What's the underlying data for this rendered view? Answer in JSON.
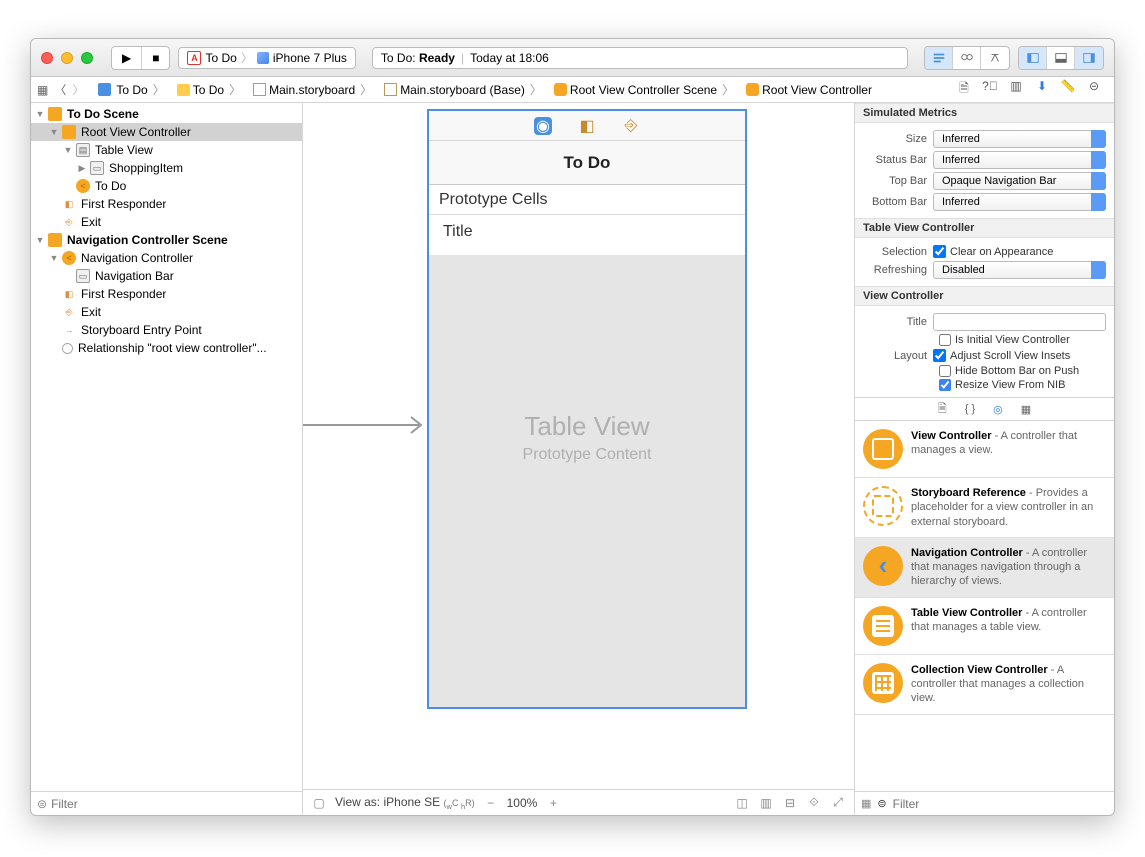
{
  "titlebar": {
    "scheme_app": "To Do",
    "scheme_device": "iPhone 7 Plus",
    "status_project": "To Do:",
    "status_state": "Ready",
    "status_time": "Today at 18:06"
  },
  "jumpbar": {
    "crumbs": [
      "To Do",
      "To Do",
      "Main.storyboard",
      "Main.storyboard (Base)",
      "Root View Controller Scene",
      "Root View Controller"
    ]
  },
  "outline": {
    "scene1": "To Do Scene",
    "rvc": "Root View Controller",
    "tv": "Table View",
    "cell": "ShoppingItem",
    "navitem": "To Do",
    "fr1": "First Responder",
    "exit1": "Exit",
    "scene2": "Navigation Controller Scene",
    "navc": "Navigation Controller",
    "navbar": "Navigation Bar",
    "fr2": "First Responder",
    "exit2": "Exit",
    "entry": "Storyboard Entry Point",
    "rel": "Relationship \"root view controller\"...",
    "filter_ph": "Filter"
  },
  "canvas": {
    "nav_title": "To Do",
    "proto_hdr": "Prototype Cells",
    "cell_title": "Title",
    "ph1": "Table View",
    "ph2": "Prototype Content",
    "footer_viewas": "View as: iPhone SE",
    "footer_wc": "(",
    "footer_w": "w",
    "footer_c": "C ",
    "footer_h": "h",
    "footer_r": "R",
    "footer_close": ")",
    "zoom": "100%"
  },
  "inspector": {
    "sim_metrics": {
      "header": "Simulated Metrics",
      "size_lbl": "Size",
      "size": "Inferred",
      "status_lbl": "Status Bar",
      "status": "Inferred",
      "top_lbl": "Top Bar",
      "top": "Opaque Navigation Bar",
      "bottom_lbl": "Bottom Bar",
      "bottom": "Inferred"
    },
    "tvc": {
      "header": "Table View Controller",
      "sel_lbl": "Selection",
      "sel_chk": "Clear on Appearance",
      "ref_lbl": "Refreshing",
      "refreshing": "Disabled"
    },
    "vc": {
      "header": "View Controller",
      "title_lbl": "Title",
      "initial": "Is Initial View Controller",
      "layout_lbl": "Layout",
      "adjust": "Adjust Scroll View Insets",
      "hide": "Hide Bottom Bar on Push",
      "resize": "Resize View From NIB"
    },
    "library": {
      "items": [
        {
          "name": "View Controller",
          "desc": " - A controller that manages a view."
        },
        {
          "name": "Storyboard Reference",
          "desc": " - Provides a placeholder for a view controller in an external storyboard."
        },
        {
          "name": "Navigation Controller",
          "desc": " - A controller that manages navigation through a hierarchy of views."
        },
        {
          "name": "Table View Controller",
          "desc": " - A controller that manages a table view."
        },
        {
          "name": "Collection View Controller",
          "desc": " - A controller that manages a collection view."
        }
      ]
    },
    "filter_ph": "Filter"
  }
}
